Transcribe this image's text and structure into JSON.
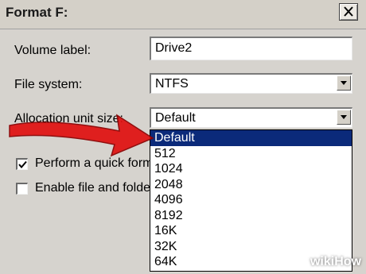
{
  "window": {
    "title": "Format F:"
  },
  "form": {
    "volume_label": {
      "label": "Volume label:",
      "value": "Drive2"
    },
    "file_system": {
      "label": "File system:",
      "value": "NTFS"
    },
    "allocation": {
      "label": "Allocation unit size:",
      "value": "Default"
    }
  },
  "options": {
    "quick_format": {
      "label": "Perform a quick format",
      "checked": true
    },
    "compression": {
      "label": "Enable file and folder compression",
      "checked": false
    }
  },
  "dropdown": {
    "items": [
      "Default",
      "512",
      "1024",
      "2048",
      "4096",
      "8192",
      "16K",
      "32K",
      "64K"
    ],
    "selected_index": 0
  },
  "watermark": {
    "prefix": "wiki",
    "suffix": "How"
  },
  "colors": {
    "selection": "#0b2a7a",
    "arrow": "#e01010"
  }
}
